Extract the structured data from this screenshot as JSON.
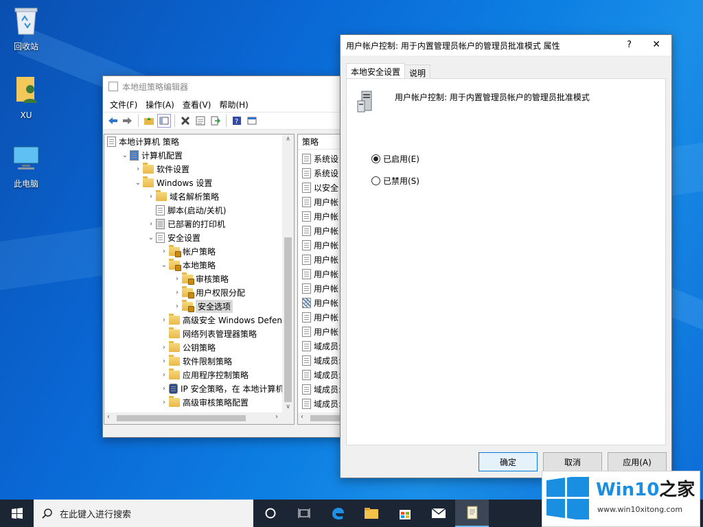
{
  "desktop": {
    "icons": [
      {
        "label": "回收站",
        "name": "recycle-bin"
      },
      {
        "label": "XU",
        "name": "user-folder"
      },
      {
        "label": "此电脑",
        "name": "this-pc"
      }
    ]
  },
  "gpedit": {
    "title": "本地组策略编辑器",
    "menus": [
      "文件(F)",
      "操作(A)",
      "查看(V)",
      "帮助(H)"
    ],
    "tree": [
      {
        "label": "本地计算机 策略",
        "indent": 0,
        "chev": "",
        "icon": "doc"
      },
      {
        "label": "计算机配置",
        "indent": 1,
        "chev": "v",
        "icon": "pc"
      },
      {
        "label": "软件设置",
        "indent": 2,
        "chev": ">",
        "icon": "folder"
      },
      {
        "label": "Windows 设置",
        "indent": 2,
        "chev": "v",
        "icon": "folder"
      },
      {
        "label": "域名解析策略",
        "indent": 3,
        "chev": ">",
        "icon": "folder"
      },
      {
        "label": "脚本(启动/关机)",
        "indent": 3,
        "chev": "",
        "icon": "doc"
      },
      {
        "label": "已部署的打印机",
        "indent": 3,
        "chev": ">",
        "icon": "printer"
      },
      {
        "label": "安全设置",
        "indent": 3,
        "chev": "v",
        "icon": "doc"
      },
      {
        "label": "帐户策略",
        "indent": 4,
        "chev": ">",
        "icon": "lockfolder"
      },
      {
        "label": "本地策略",
        "indent": 4,
        "chev": "v",
        "icon": "lockfolder"
      },
      {
        "label": "审核策略",
        "indent": 5,
        "chev": ">",
        "icon": "lockfolder"
      },
      {
        "label": "用户权限分配",
        "indent": 5,
        "chev": ">",
        "icon": "lockfolder"
      },
      {
        "label": "安全选项",
        "indent": 5,
        "chev": ">",
        "icon": "lockfolder",
        "selected": true
      },
      {
        "label": "高级安全 Windows Defende",
        "indent": 4,
        "chev": ">",
        "icon": "folder"
      },
      {
        "label": "网络列表管理器策略",
        "indent": 4,
        "chev": "",
        "icon": "folder"
      },
      {
        "label": "公钥策略",
        "indent": 4,
        "chev": ">",
        "icon": "folder"
      },
      {
        "label": "软件限制策略",
        "indent": 4,
        "chev": ">",
        "icon": "folder"
      },
      {
        "label": "应用程序控制策略",
        "indent": 4,
        "chev": ">",
        "icon": "folder"
      },
      {
        "label": "IP 安全策略，在 本地计算机",
        "indent": 4,
        "chev": ">",
        "icon": "shield"
      },
      {
        "label": "高级审核策略配置",
        "indent": 4,
        "chev": ">",
        "icon": "folder"
      }
    ],
    "policy_header": "策略",
    "policies": [
      "系统设",
      "系统设",
      "以安全",
      "用户帐",
      "用户帐",
      "用户帐",
      "用户帐",
      "用户帐",
      "用户帐",
      "用户帐",
      "用户帐",
      "用户帐",
      "用户帐",
      "域成员:",
      "域成员:",
      "域成员:",
      "域成员:",
      "域成员:"
    ],
    "highlighted_policy": 10
  },
  "dialog": {
    "title": "用户帐户控制: 用于内置管理员帐户的管理员批准模式 属性",
    "help": "?",
    "close": "✕",
    "tabs": [
      "本地安全设置",
      "说明"
    ],
    "policy_name": "用户帐户控制: 用于内置管理员帐户的管理员批准模式",
    "enabled_label": "已启用(E)",
    "disabled_label": "已禁用(S)",
    "enabled": true,
    "ok": "确定",
    "cancel": "取消",
    "apply": "应用(A)"
  },
  "taskbar": {
    "search_placeholder": "在此键入进行搜索"
  },
  "watermark": {
    "brand_a": "Win10",
    "brand_b": "之家",
    "url": "www.win10xitong.com"
  }
}
